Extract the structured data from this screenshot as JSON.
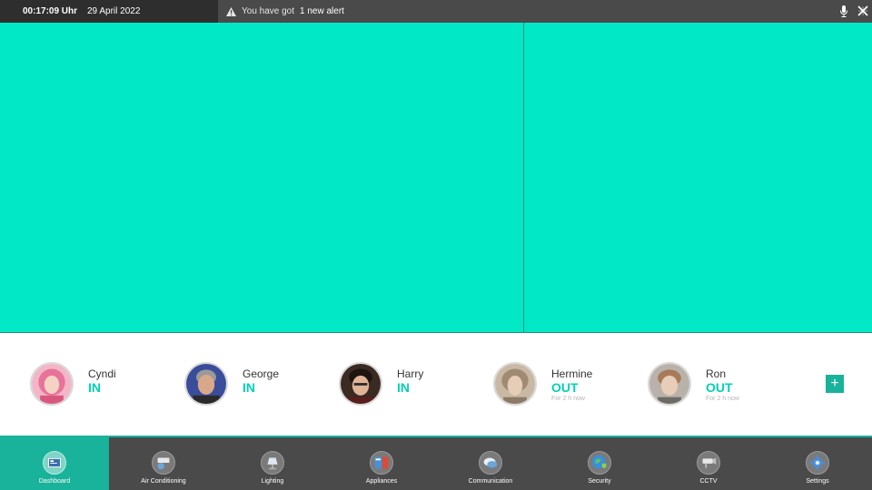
{
  "topbar": {
    "time": "00:17:09 Uhr",
    "date": "29 April 2022",
    "alert_prefix": "You have got",
    "alert_count": "1 new alert"
  },
  "residents": [
    {
      "name": "Cyndi",
      "status": "IN",
      "since": ""
    },
    {
      "name": "George",
      "status": "IN",
      "since": ""
    },
    {
      "name": "Harry",
      "status": "IN",
      "since": ""
    },
    {
      "name": "Hermine",
      "status": "OUT",
      "since": "For 2 h now"
    },
    {
      "name": "Ron",
      "status": "OUT",
      "since": "For 2 h now"
    }
  ],
  "add_label": "+",
  "nav": [
    {
      "label": "Dashboard",
      "icon": "dashboard-icon"
    },
    {
      "label": "Air Conditioning",
      "icon": "air-conditioning-icon"
    },
    {
      "label": "Lighting",
      "icon": "lamp-icon"
    },
    {
      "label": "Appliances",
      "icon": "appliances-icon"
    },
    {
      "label": "Communication",
      "icon": "chat-icon"
    },
    {
      "label": "Security",
      "icon": "globe-shield-icon"
    },
    {
      "label": "CCTV",
      "icon": "camera-icon"
    },
    {
      "label": "Settings",
      "icon": "gear-icon"
    }
  ],
  "colors": {
    "accent": "#00e8c6",
    "nav_active": "#19b29a",
    "status": "#00d1b5",
    "dark": "#4a4a4a"
  }
}
